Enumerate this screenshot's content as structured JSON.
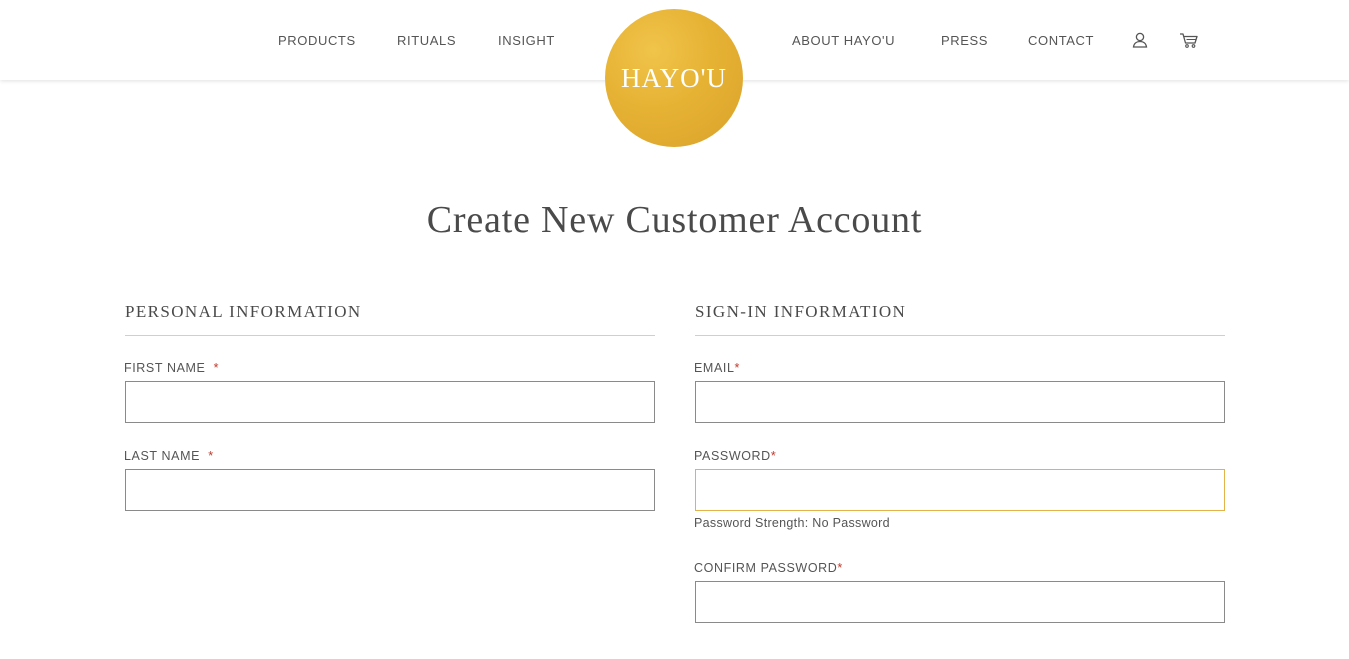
{
  "nav": {
    "left": [
      "PRODUCTS",
      "RITUALS",
      "INSIGHT"
    ],
    "right": [
      "ABOUT HAYO'U",
      "PRESS",
      "CONTACT"
    ],
    "account_icon": "user-icon",
    "cart_icon": "cart-icon"
  },
  "logo": {
    "text": "HAYO'U",
    "color": "#e6b234"
  },
  "page_title": "Create New Customer Account",
  "personal": {
    "title": "PERSONAL INFORMATION",
    "first_name_label": "FIRST NAME",
    "last_name_label": "LAST NAME",
    "required_mark": "*"
  },
  "signin": {
    "title": "SIGN-IN INFORMATION",
    "email_label": "EMAIL",
    "password_label": "PASSWORD",
    "password_strength": "Password Strength: No Password",
    "confirm_password_label": "CONFIRM PASSWORD",
    "required_mark": "*"
  },
  "colors": {
    "required": "#c0392b",
    "focus_border": "#e3b24a"
  }
}
